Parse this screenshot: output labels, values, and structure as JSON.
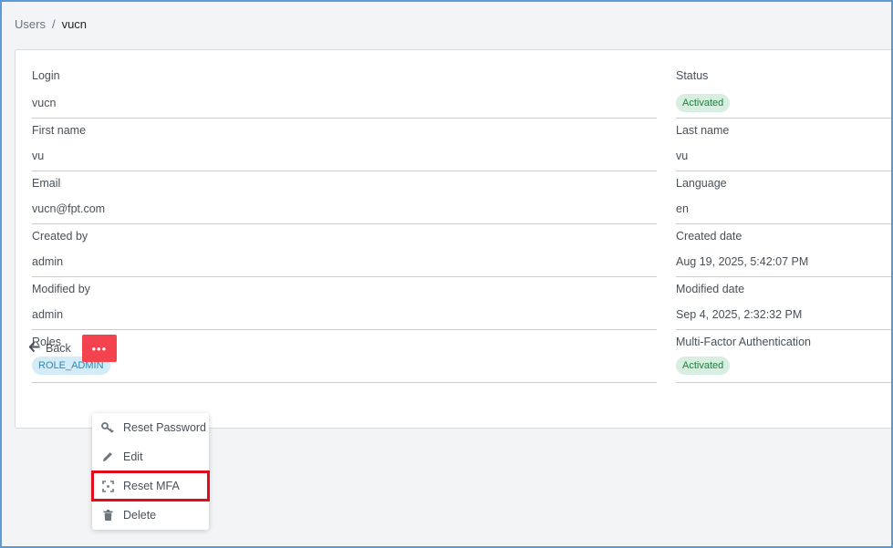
{
  "breadcrumb": {
    "root": "Users",
    "separator": "/",
    "current": "vucn"
  },
  "left_fields": [
    {
      "label": "Login",
      "value": "vucn"
    },
    {
      "label": "First name",
      "value": "vu"
    },
    {
      "label": "Email",
      "value": "vucn@fpt.com"
    },
    {
      "label": "Created by",
      "value": "admin"
    },
    {
      "label": "Modified by",
      "value": "admin"
    },
    {
      "label": "Roles",
      "badge": "ROLE_ADMIN"
    }
  ],
  "right_fields": [
    {
      "label": "Status",
      "badge": "Activated"
    },
    {
      "label": "Last name",
      "value": "vu"
    },
    {
      "label": "Language",
      "value": "en"
    },
    {
      "label": "Created date",
      "value": "Aug 19, 2025, 5:42:07 PM"
    },
    {
      "label": "Modified date",
      "value": "Sep 4, 2025, 2:32:32 PM"
    },
    {
      "label": "Multi-Factor Authentication",
      "badge": "Activated"
    }
  ],
  "actions": {
    "back_label": "Back",
    "more_label": "•••"
  },
  "menu": {
    "items": [
      {
        "label": "Reset Password",
        "icon": "key-icon"
      },
      {
        "label": "Edit",
        "icon": "pencil-icon"
      },
      {
        "label": "Reset MFA",
        "icon": "reset-icon",
        "highlighted": true
      },
      {
        "label": "Delete",
        "icon": "trash-icon"
      }
    ]
  },
  "colors": {
    "danger": "#f2434f",
    "success_bg": "#d7eee0",
    "success_text": "#1e7e3c",
    "info_bg": "#d3ecf7",
    "info_text": "#2a88b8",
    "highlight_border": "#e00b1c"
  }
}
